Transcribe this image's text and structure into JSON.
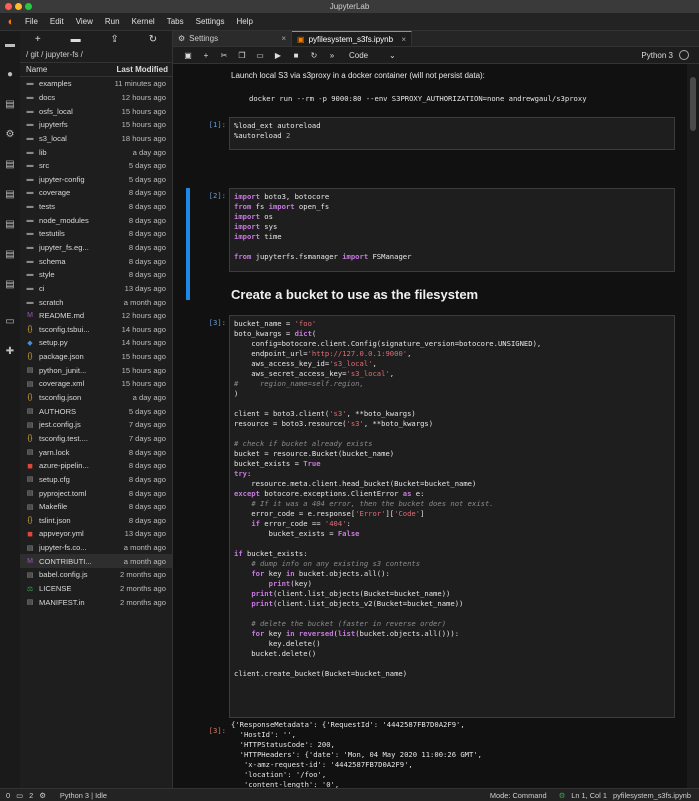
{
  "window": {
    "title": "JupyterLab"
  },
  "menu": [
    "File",
    "Edit",
    "View",
    "Run",
    "Kernel",
    "Tabs",
    "Settings",
    "Help"
  ],
  "filebrowser": {
    "path": "/ git / jupyter-fs /",
    "col_name": "Name",
    "col_modified": "Last Modified",
    "items": [
      {
        "name": "examples",
        "modified": "11 minutes ago",
        "type": "folder"
      },
      {
        "name": "docs",
        "modified": "12 hours ago",
        "type": "folder"
      },
      {
        "name": "osfs_local",
        "modified": "15 hours ago",
        "type": "folder"
      },
      {
        "name": "jupyterfs",
        "modified": "15 hours ago",
        "type": "folder"
      },
      {
        "name": "s3_local",
        "modified": "18 hours ago",
        "type": "folder"
      },
      {
        "name": "lib",
        "modified": "a day ago",
        "type": "folder"
      },
      {
        "name": "src",
        "modified": "5 days ago",
        "type": "folder"
      },
      {
        "name": "jupyter-config",
        "modified": "5 days ago",
        "type": "folder"
      },
      {
        "name": "coverage",
        "modified": "8 days ago",
        "type": "folder"
      },
      {
        "name": "tests",
        "modified": "8 days ago",
        "type": "folder"
      },
      {
        "name": "node_modules",
        "modified": "8 days ago",
        "type": "folder"
      },
      {
        "name": "testutils",
        "modified": "8 days ago",
        "type": "folder"
      },
      {
        "name": "jupyter_fs.eg...",
        "modified": "8 days ago",
        "type": "folder"
      },
      {
        "name": "schema",
        "modified": "8 days ago",
        "type": "folder"
      },
      {
        "name": "style",
        "modified": "8 days ago",
        "type": "folder"
      },
      {
        "name": "ci",
        "modified": "13 days ago",
        "type": "folder"
      },
      {
        "name": "scratch",
        "modified": "a month ago",
        "type": "folder"
      },
      {
        "name": "README.md",
        "modified": "12 hours ago",
        "type": "md"
      },
      {
        "name": "tsconfig.tsbui...",
        "modified": "14 hours ago",
        "type": "json"
      },
      {
        "name": "setup.py",
        "modified": "14 hours ago",
        "type": "py"
      },
      {
        "name": "package.json",
        "modified": "15 hours ago",
        "type": "json"
      },
      {
        "name": "python_junit...",
        "modified": "15 hours ago",
        "type": "file"
      },
      {
        "name": "coverage.xml",
        "modified": "15 hours ago",
        "type": "file"
      },
      {
        "name": "tsconfig.json",
        "modified": "a day ago",
        "type": "json"
      },
      {
        "name": "AUTHORS",
        "modified": "5 days ago",
        "type": "file"
      },
      {
        "name": "jest.config.js",
        "modified": "7 days ago",
        "type": "file"
      },
      {
        "name": "tsconfig.test....",
        "modified": "7 days ago",
        "type": "json"
      },
      {
        "name": "yarn.lock",
        "modified": "8 days ago",
        "type": "file"
      },
      {
        "name": "azure-pipelin...",
        "modified": "8 days ago",
        "type": "red"
      },
      {
        "name": "setup.cfg",
        "modified": "8 days ago",
        "type": "file"
      },
      {
        "name": "pyproject.toml",
        "modified": "8 days ago",
        "type": "file"
      },
      {
        "name": "Makefile",
        "modified": "8 days ago",
        "type": "file"
      },
      {
        "name": "tslint.json",
        "modified": "8 days ago",
        "type": "json"
      },
      {
        "name": "appveyor.yml",
        "modified": "13 days ago",
        "type": "red"
      },
      {
        "name": "jupyter-fs.co...",
        "modified": "a month ago",
        "type": "file"
      },
      {
        "name": "CONTRIBUTI...",
        "modified": "a month ago",
        "type": "md",
        "selected": true
      },
      {
        "name": "babel.config.js",
        "modified": "2 months ago",
        "type": "file"
      },
      {
        "name": "LICENSE",
        "modified": "2 months ago",
        "type": "green"
      },
      {
        "name": "MANIFEST.in",
        "modified": "2 months ago",
        "type": "file"
      }
    ]
  },
  "tabs": {
    "settings": "Settings",
    "notebook": "pyfilesystem_s3fs.ipynb"
  },
  "toolbar": {
    "cell_type": "Code",
    "kernel": "Python 3"
  },
  "notebook": {
    "md_launch": "Launch local S3 via s3proxy in a docker container (will not persist data):",
    "md_docker": "docker run --rm -p 9000:80 --env S3PROXY_AUTHORIZATION=none andrewgaul/s3proxy",
    "prompt1": "[1]:",
    "prompt2": "[2]:",
    "heading": "Create a bucket to use as the filesystem",
    "prompt3": "[3]:",
    "prompt3out": "[3]:"
  },
  "status": {
    "left_a": "0",
    "left_b": "2",
    "kernel": "Python 3 | Idle",
    "mode": "Mode: Command",
    "pos": "Ln 1, Col 1",
    "file": "pyfilesystem_s3fs.ipynb"
  }
}
